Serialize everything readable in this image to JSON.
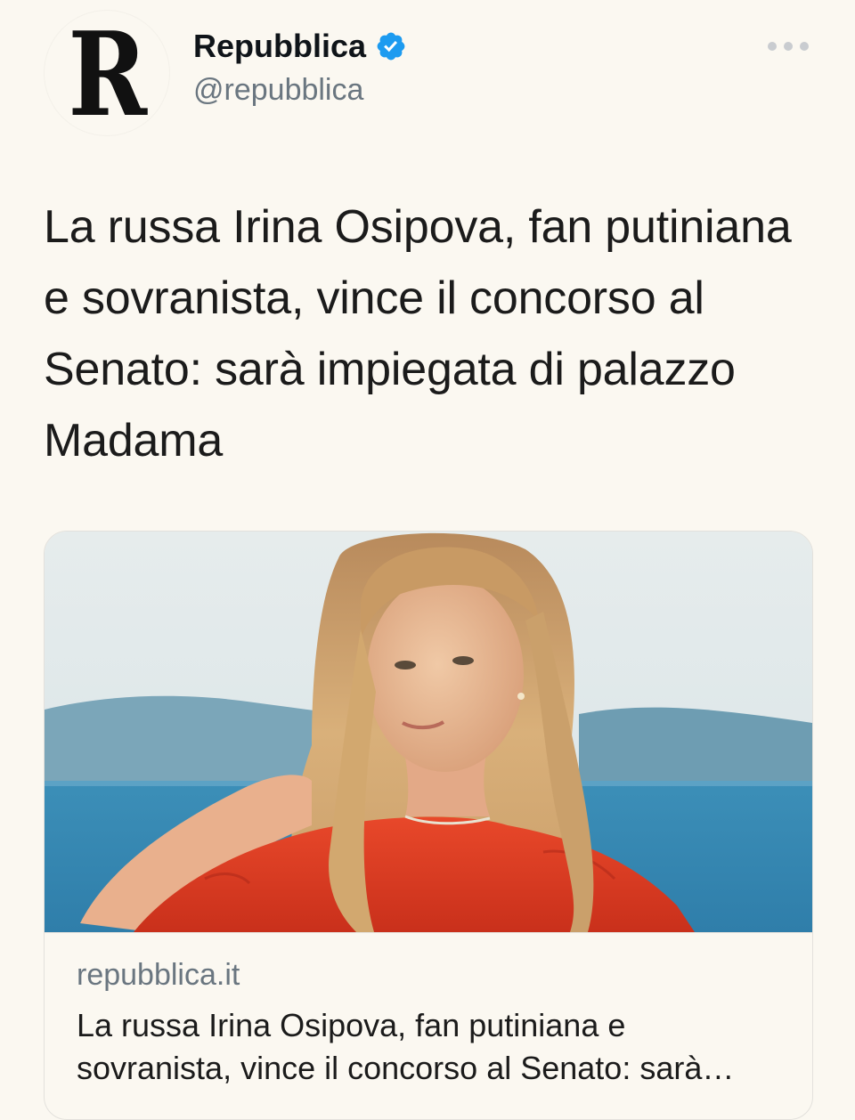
{
  "author": {
    "display_name": "Repubblica",
    "handle": "@repubblica",
    "avatar_letter": "R",
    "verified": true,
    "verified_color": "#1d9bf0"
  },
  "header": {
    "more_icon": "more-horizontal-icon"
  },
  "tweet": {
    "text": "La russa Irina Osipova, fan putiniana e sovranista, vince il concorso al Senato: sarà impiegata di palazzo Madama"
  },
  "link_card": {
    "domain": "repubblica.it",
    "title": "La russa Irina Osipova, fan putiniana e sovranista, vince il concorso al Senato: sarà impiegata di palazzo Madama"
  },
  "colors": {
    "background": "#fbf8f1",
    "text_primary": "#0f1419",
    "text_secondary": "#6a7680"
  }
}
